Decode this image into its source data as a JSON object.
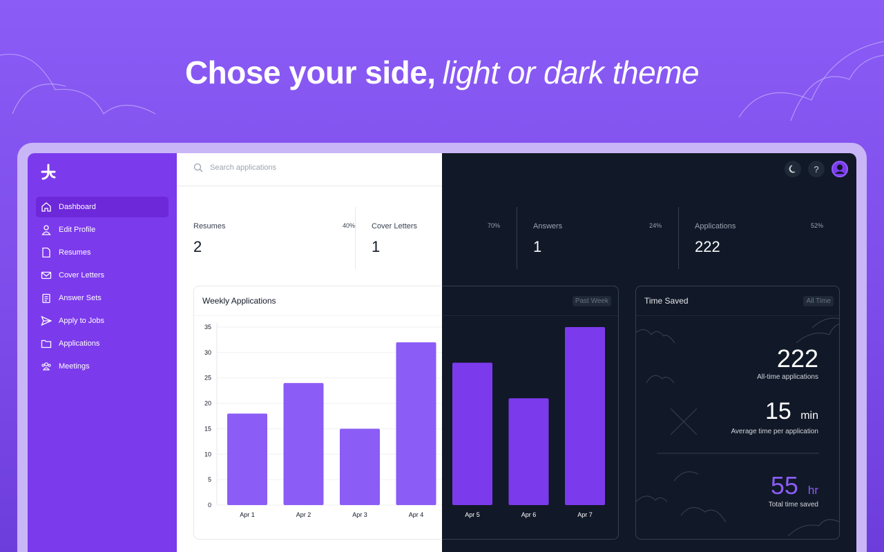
{
  "headline": {
    "bold": "Chose your side,",
    "italic": "light or dark theme"
  },
  "sidebar": {
    "items": [
      {
        "label": "Dashboard",
        "icon": "home-icon",
        "active": true
      },
      {
        "label": "Edit Profile",
        "icon": "user-icon",
        "active": false
      },
      {
        "label": "Resumes",
        "icon": "document-icon",
        "active": false
      },
      {
        "label": "Cover Letters",
        "icon": "mail-icon",
        "active": false
      },
      {
        "label": "Answer Sets",
        "icon": "clipboard-icon",
        "active": false
      },
      {
        "label": "Apply to Jobs",
        "icon": "send-icon",
        "active": false
      },
      {
        "label": "Applications",
        "icon": "folder-icon",
        "active": false
      },
      {
        "label": "Meetings",
        "icon": "users-icon",
        "active": false
      }
    ]
  },
  "search": {
    "placeholder": "Search applications"
  },
  "topbar": {
    "help": "?"
  },
  "stats": [
    {
      "label": "Resumes",
      "pct": "40%",
      "value": "2"
    },
    {
      "label": "Cover Letters",
      "pct": "70%",
      "value": "1"
    },
    {
      "label": "Answers",
      "pct": "24%",
      "value": "1"
    },
    {
      "label": "Applications",
      "pct": "52%",
      "value": "222"
    }
  ],
  "weekly": {
    "title": "Weekly Applications",
    "range": "Past Week"
  },
  "time_saved": {
    "title": "Time Saved",
    "range": "All Time",
    "apps_value": "222",
    "apps_label": "All-time applications",
    "avg_value": "15",
    "avg_unit": "min",
    "avg_label": "Average time per application",
    "total_value": "55",
    "total_unit": "hr",
    "total_label": "Total time saved"
  },
  "colors": {
    "accent": "#7c3aed",
    "bar_light": "#8b5cf6",
    "bar_dark": "#7c3aed",
    "dark_bg": "#111827"
  },
  "chart_data": {
    "type": "bar",
    "title": "Weekly Applications",
    "categories": [
      "Apr 1",
      "Apr 2",
      "Apr 3",
      "Apr 4",
      "Apr 5",
      "Apr 6",
      "Apr 7"
    ],
    "values": [
      18,
      24,
      15,
      32,
      28,
      21,
      35
    ],
    "yticks": [
      0,
      5,
      10,
      15,
      20,
      25,
      30,
      35
    ],
    "ylim": [
      0,
      35
    ],
    "grid": true
  }
}
